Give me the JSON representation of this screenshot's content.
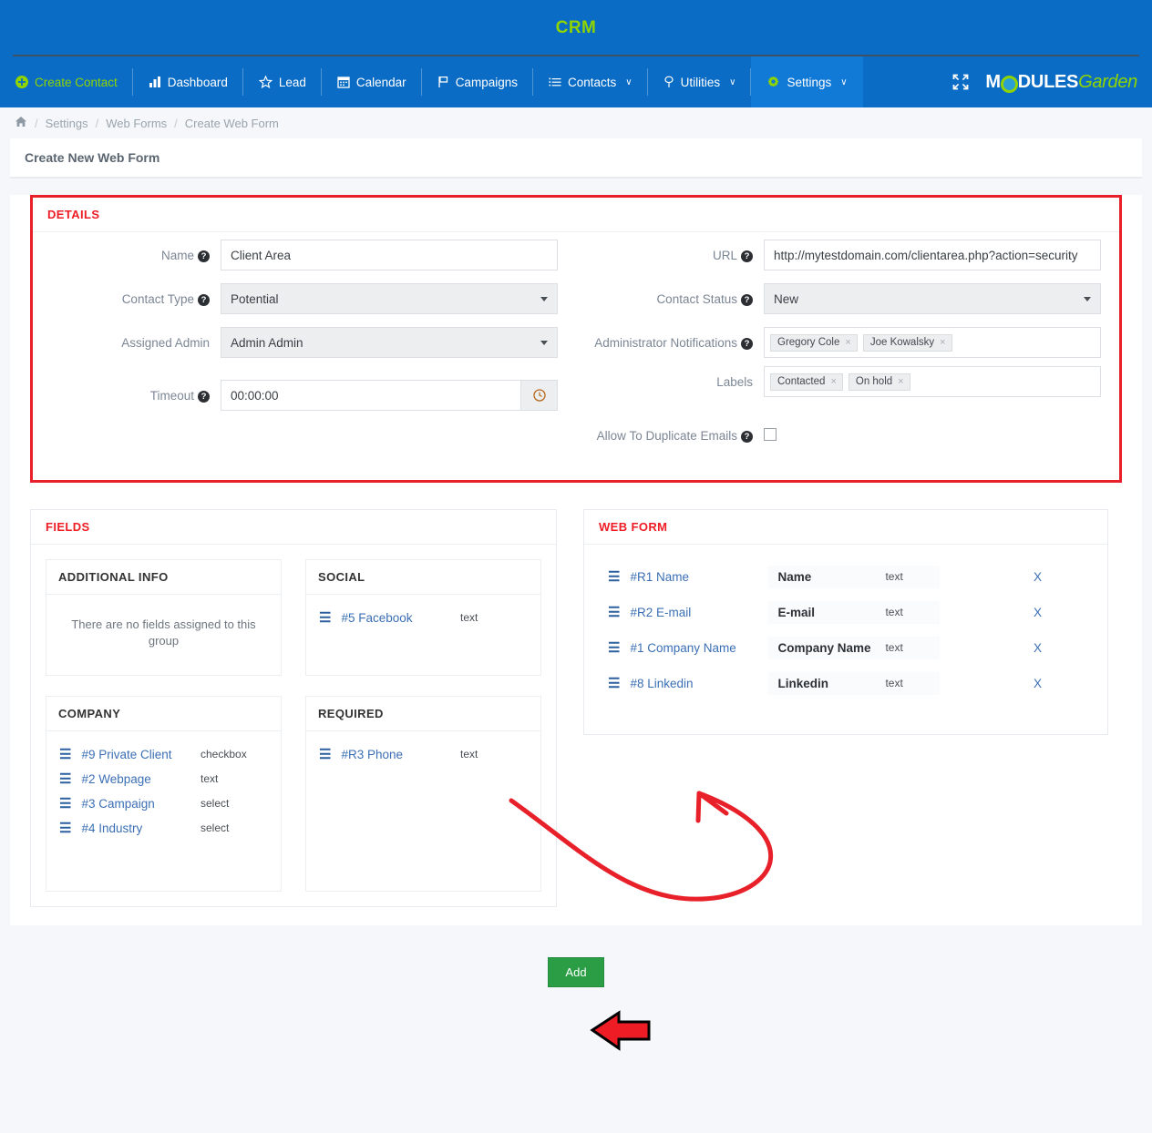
{
  "brand": {
    "title": "CRM",
    "logo_part1": "M",
    "logo_part2": "DULES",
    "logo_part3": "Garden"
  },
  "nav": {
    "items": [
      {
        "label": "Create Contact",
        "icon": "plus-circle-icon",
        "style": "green",
        "caret": false
      },
      {
        "label": "Dashboard",
        "icon": "bar-chart-icon",
        "style": "white",
        "caret": false
      },
      {
        "label": "Lead",
        "icon": "star-icon",
        "style": "white",
        "caret": false
      },
      {
        "label": "Calendar",
        "icon": "calendar-icon",
        "style": "white",
        "caret": false
      },
      {
        "label": "Campaigns",
        "icon": "flag-icon",
        "style": "white",
        "caret": false
      },
      {
        "label": "Contacts",
        "icon": "list-icon",
        "style": "white",
        "caret": true
      },
      {
        "label": "Utilities",
        "icon": "map-pin-icon",
        "style": "white",
        "caret": true
      },
      {
        "label": "Settings",
        "icon": "gear-icon",
        "style": "white",
        "caret": true,
        "active": true
      }
    ],
    "caret_glyph": "∨",
    "expand_icon": "expand-arrows-icon"
  },
  "breadcrumb": {
    "home_icon": "home-icon",
    "separator": "/",
    "items": [
      "Settings",
      "Web Forms",
      "Create Web Form"
    ]
  },
  "panel": {
    "header": "Create New Web Form"
  },
  "details": {
    "title": "DETAILS",
    "left": {
      "name": {
        "label": "Name",
        "help": "?",
        "value": "Client Area",
        "placeholder": ""
      },
      "contact_type": {
        "label": "Contact Type",
        "help": "?",
        "value": "Potential"
      },
      "assigned_admin": {
        "label": "Assigned Admin",
        "help": "",
        "value": "Admin Admin"
      },
      "timeout": {
        "label": "Timeout",
        "help": "?",
        "value": "00:00:00",
        "addon_icon": "clock-icon"
      }
    },
    "right": {
      "url": {
        "label": "URL",
        "help": "?",
        "value": "http://mytestdomain.com/clientarea.php?action=security"
      },
      "contact_status": {
        "label": "Contact Status",
        "help": "?",
        "value": "New"
      },
      "admin_notifications": {
        "label": "Administrator Notifications",
        "help": "?",
        "tags": [
          "Gregory Cole",
          "Joe Kowalsky"
        ],
        "remove_glyph": "×"
      },
      "labels": {
        "label": "Labels",
        "help": "",
        "tags": [
          "Contacted",
          "On hold"
        ],
        "remove_glyph": "×"
      },
      "allow_duplicate_emails": {
        "label": "Allow To Duplicate Emails",
        "help": "?",
        "checked": false
      }
    }
  },
  "fields_panel": {
    "title": "FIELDS",
    "groups": [
      {
        "name": "ADDITIONAL INFO",
        "color_class": "olive",
        "empty_message": "There are no fields assigned to this group",
        "items": []
      },
      {
        "name": "SOCIAL",
        "color_class": "blue",
        "empty_message": "",
        "items": [
          {
            "name": "#5 Facebook",
            "type": "text",
            "grip": "☰"
          }
        ]
      },
      {
        "name": "COMPANY",
        "color_class": "red",
        "empty_message": "",
        "items": [
          {
            "name": "#9 Private Client",
            "type": "checkbox",
            "grip": "☰"
          },
          {
            "name": "#2 Webpage",
            "type": "text",
            "grip": "☰"
          },
          {
            "name": "#3 Campaign",
            "type": "select",
            "grip": "☰"
          },
          {
            "name": "#4 Industry",
            "type": "select",
            "grip": "☰"
          }
        ]
      },
      {
        "name": "REQUIRED",
        "color_class": "black",
        "empty_message": "",
        "items": [
          {
            "name": "#R3 Phone",
            "type": "text",
            "grip": "☰"
          }
        ]
      }
    ]
  },
  "web_form_panel": {
    "title": "WEB FORM",
    "remove_label": "X",
    "rows": [
      {
        "field": "#R1 Name",
        "label": "Name",
        "type": "text",
        "grip": "☰"
      },
      {
        "field": "#R2 E-mail",
        "label": "E-mail",
        "type": "text",
        "grip": "☰"
      },
      {
        "field": "#1 Company Name",
        "label": "Company Name",
        "type": "text",
        "grip": "☰"
      },
      {
        "field": "#8 Linkedin",
        "label": "Linkedin",
        "type": "text",
        "grip": "☰"
      }
    ]
  },
  "footer": {
    "add_label": "Add"
  },
  "annotations": {
    "highlight_color": "#e8202a",
    "arrow_color": "#e8202a",
    "pointer_fill": "#ee1c24",
    "pointer_stroke": "#000000"
  }
}
